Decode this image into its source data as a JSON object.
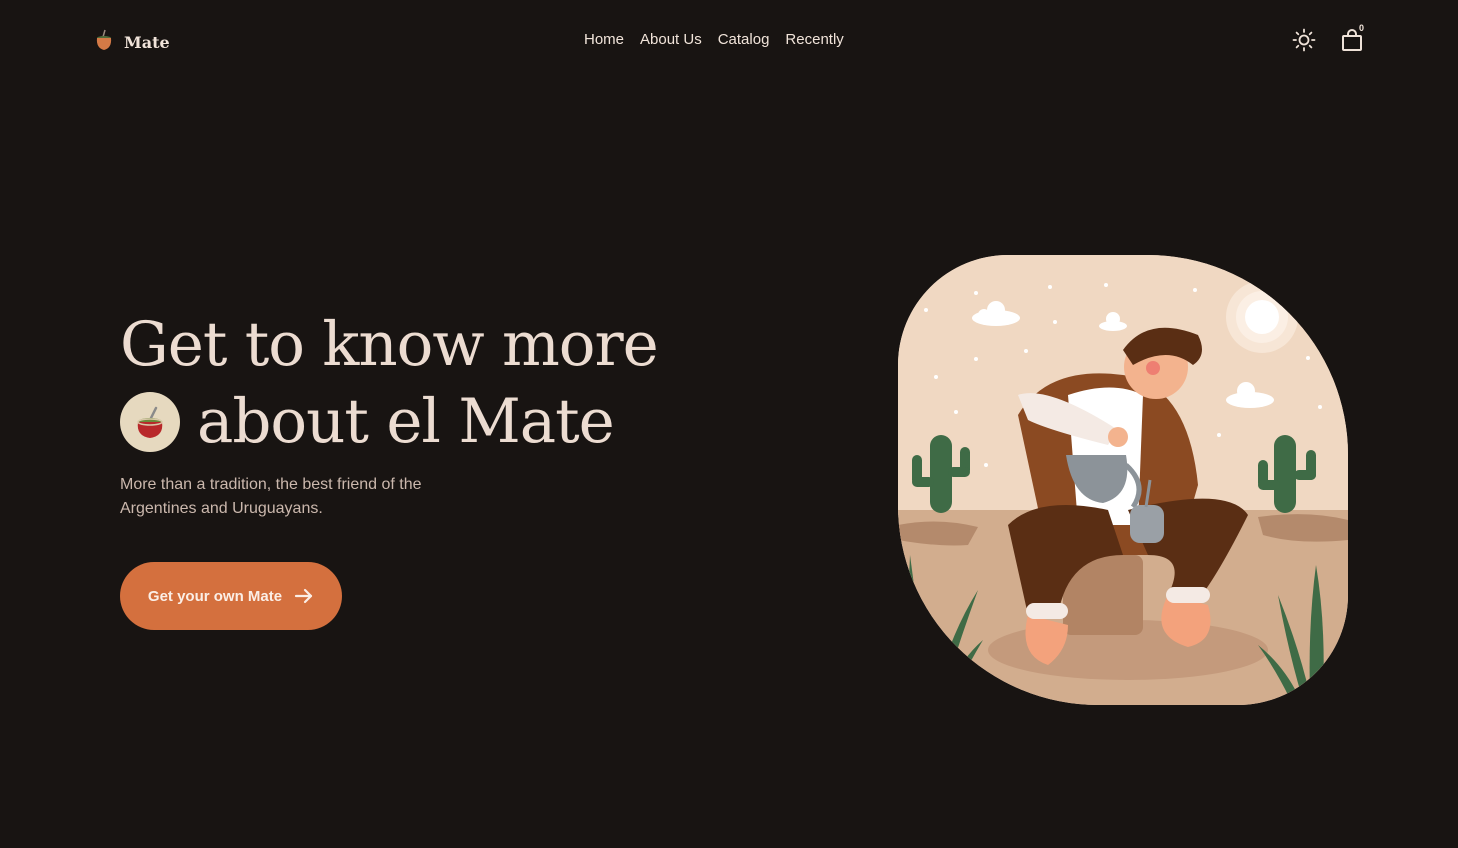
{
  "header": {
    "logo_text": "Mate",
    "nav": [
      {
        "label": "Home"
      },
      {
        "label": "About Us"
      },
      {
        "label": "Catalog"
      },
      {
        "label": "Recently"
      }
    ],
    "theme_icon": "sun-icon",
    "cart_icon": "shopping-bag-icon",
    "cart_count": "0"
  },
  "hero": {
    "title_line1": "Get to know more",
    "title_line2": "about el Mate",
    "description": "More than a tradition, the best friend of the Argentines and Uruguayans.",
    "cta_label": "Get your own Mate",
    "cta_icon": "arrow-right-icon"
  },
  "colors": {
    "background": "#181412",
    "accent": "#d4703e",
    "text": "#ecdcd1"
  }
}
